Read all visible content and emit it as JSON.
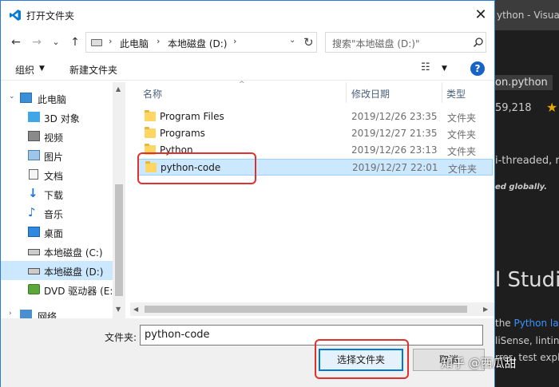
{
  "dialog": {
    "title": "打开文件夹",
    "close": "✕"
  },
  "nav": {
    "back": "←",
    "forward": "→",
    "recent": "⌄",
    "up": "↑",
    "address": [
      "此电脑",
      "本地磁盘 (D:)"
    ],
    "search_placeholder": "搜索\"本地磁盘 (D:)\""
  },
  "toolbar": {
    "organize": "组织",
    "new_folder": "新建文件夹"
  },
  "sidebar": {
    "items": [
      {
        "label": "此电脑",
        "icon": "pc-icon"
      },
      {
        "label": "3D 对象",
        "icon": "3d-objects-icon"
      },
      {
        "label": "视频",
        "icon": "video-icon"
      },
      {
        "label": "图片",
        "icon": "pictures-icon"
      },
      {
        "label": "文档",
        "icon": "documents-icon"
      },
      {
        "label": "下载",
        "icon": "downloads-icon"
      },
      {
        "label": "音乐",
        "icon": "music-icon"
      },
      {
        "label": "桌面",
        "icon": "desktop-icon"
      },
      {
        "label": "本地磁盘 (C:)",
        "icon": "drive-icon"
      },
      {
        "label": "本地磁盘 (D:)",
        "icon": "drive-icon",
        "selected": true
      },
      {
        "label": "DVD 驱动器 (E:)",
        "icon": "dvd-icon"
      },
      {
        "label": "网络",
        "icon": "network-icon"
      }
    ]
  },
  "list": {
    "columns": [
      "名称",
      "修改日期",
      "类型"
    ],
    "rows": [
      {
        "name": "Program Files",
        "date": "2019/12/26 23:35",
        "type": "文件夹"
      },
      {
        "name": "Programs",
        "date": "2019/12/27 21:35",
        "type": "文件夹"
      },
      {
        "name": "Python",
        "date": "2019/12/26 23:13",
        "type": "文件夹"
      },
      {
        "name": "python-code",
        "date": "2019/12/27 22:01",
        "type": "文件夹",
        "selected": true
      }
    ]
  },
  "bottom": {
    "folder_label": "文件夹:",
    "folder_value": "python-code",
    "select_button": "选择文件夹",
    "cancel_button": "取消"
  },
  "background": {
    "title_fragment": "ython - Visual S",
    "pill": "on.python",
    "count": "59,218",
    "line1": "i-threaded, re",
    "line2": "ed globally.",
    "big": "l Studio",
    "l3_prefix": "the ",
    "l3_link": "Python lar",
    "l4": "liSense, lintin",
    "l5": "rrer, test explo"
  },
  "watermark": "知乎 @西瓜甜",
  "colors": {
    "accent": "#0078d7",
    "selection": "#cce8ff",
    "highlight": "#e0312f"
  }
}
